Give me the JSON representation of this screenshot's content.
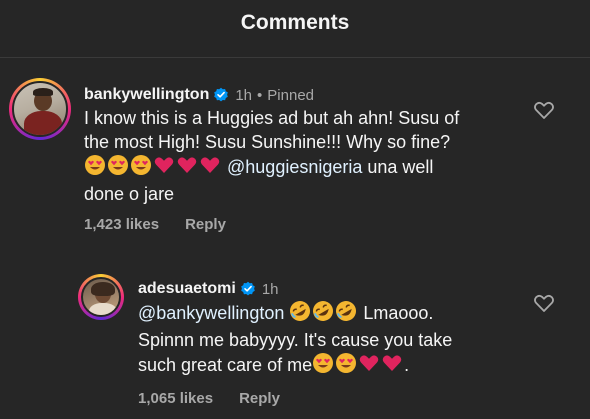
{
  "header": {
    "title": "Comments"
  },
  "comments": [
    {
      "username": "bankywellington",
      "time": "1h",
      "pinned": "Pinned",
      "text_line1": "I know this is a Huggies ad but ah ahn! Susu of",
      "text_line2": "the most High! Susu Sunshine!!! Why so fine?",
      "mention": "@huggiesnigeria",
      "text_after_mention": " una well",
      "text_line4": "done o jare",
      "likes": "1,423 likes",
      "reply": "Reply"
    },
    {
      "username": "adesuaetomi",
      "time": "1h",
      "mention": "@bankywellington",
      "text_after_emoji": " Lmaooo.",
      "text_line2": "Spinnn me babyyyy. It's cause you take",
      "text_line3": "such great care of me",
      "text_end": ".",
      "likes": "1,065 likes",
      "reply": "Reply"
    }
  ],
  "colors": {
    "background": "#262626",
    "verified": "#0095f6",
    "heart_red": "#e0245e"
  },
  "icons": [
    "verified-badge-icon",
    "heart-outline-icon",
    "heart-eyes-emoji",
    "red-heart-emoji",
    "rofl-emoji"
  ]
}
